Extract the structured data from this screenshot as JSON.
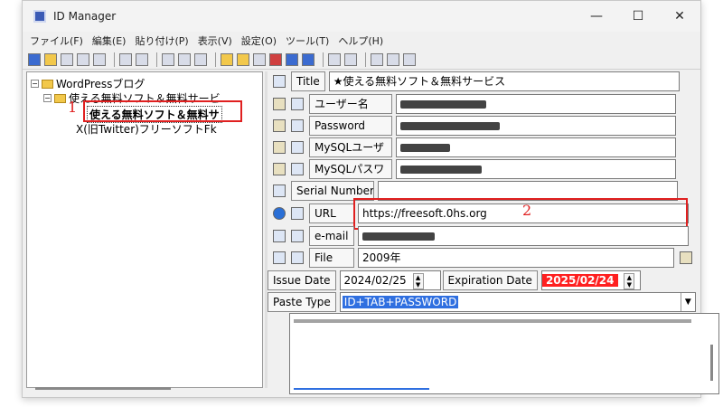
{
  "window": {
    "title": "ID Manager",
    "controls": {
      "minimize": "—",
      "maximize": "☐",
      "close": "✕"
    }
  },
  "menu": [
    "ファイル(F)",
    "編集(E)",
    "貼り付け(P)",
    "表示(V)",
    "設定(O)",
    "ツール(T)",
    "ヘルプ(H)"
  ],
  "tree": {
    "root": "WordPressブログ",
    "child": "使える無料ソフト＆無料サービ",
    "selected": "使える無料ソフト＆無料サ",
    "sibling": "X(旧Twitter)フリーソフトFk"
  },
  "annotations": {
    "one": "1",
    "two": "2"
  },
  "form": {
    "title_label": "Title",
    "title_value": "★使える無料ソフト＆無料サービス",
    "user_label": "ユーザー名",
    "password_label": "Password",
    "mysql_user_label": "MySQLユーザ",
    "mysql_pass_label": "MySQLパスワ",
    "serial_label": "Serial Number",
    "url_label": "URL",
    "url_value": "https://freesoft.0hs.org",
    "email_label": "e-mail",
    "file_label": "File",
    "file_value": "2009年",
    "issue_label": "Issue Date",
    "issue_value": "2024/02/25",
    "expiration_label": "Expiration Date",
    "expiration_value": "2025/02/24",
    "paste_label": "Paste Type",
    "paste_value": "ID+TAB+PASSWORD"
  },
  "colors": {
    "accent_red": "#e02020",
    "expired_bg": "#ff2020",
    "selection_blue": "#2f6fe0"
  }
}
